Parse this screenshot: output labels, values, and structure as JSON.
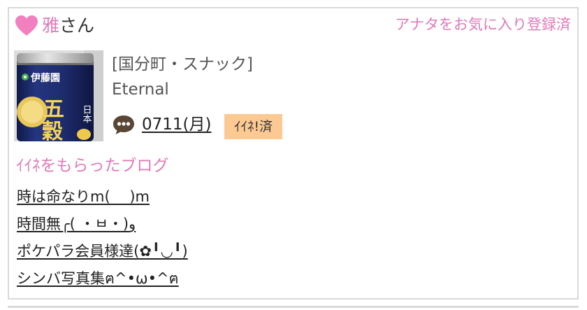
{
  "header": {
    "user_name": "雅",
    "honorific": "さん",
    "favorite_status": "アナタをお気に入り登録済"
  },
  "shop": {
    "category": "[国分町・スナック]",
    "name": "Eternal",
    "thumbnail_text": {
      "brand": "伊藤園",
      "product": "五穀",
      "side": "日本"
    }
  },
  "visit": {
    "date": "0711(月)",
    "like_status": "ｲｲﾈ!済"
  },
  "liked_blogs": {
    "heading": "ｲｲﾈをもらったブログ",
    "items": [
      "時は命なりm(_ _)m",
      "時間無╭( ・ㅂ・)و",
      "ポケパラ会員様達(✿╹◡╹)",
      "シンバ写真集ฅ^•ω•^ฅ"
    ]
  },
  "colors": {
    "accent_pink": "#e07ab8",
    "badge_orange": "#fcc993",
    "border_gray": "#d9d9d9",
    "can_navy": "#1e2c6e"
  }
}
